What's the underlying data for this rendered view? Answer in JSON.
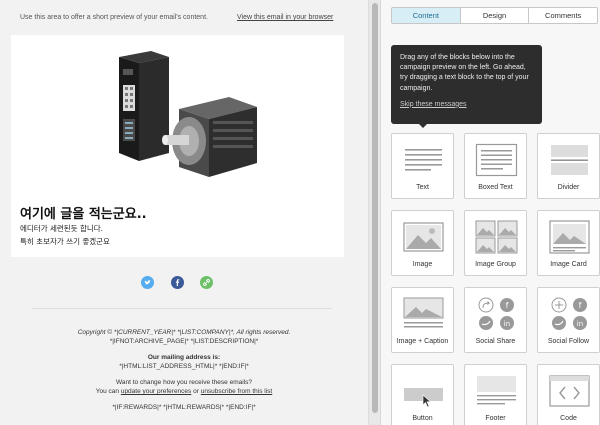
{
  "preview": {
    "preheader_text": "Use this area to offer a short preview of your email's content.",
    "view_in_browser": "View this email in your browser",
    "headline": "여기에 글을 적는군요..",
    "body_line1": "에디터가 세련된듯 합니다.",
    "body_line2": "특히 초보자가 쓰기 좋겠군요",
    "social_icons": [
      {
        "name": "twitter-icon",
        "color": "#55acee"
      },
      {
        "name": "facebook-icon",
        "color": "#3b5998"
      },
      {
        "name": "link-icon",
        "color": "#6dc067"
      }
    ],
    "footer": {
      "copyright": "Copyright © *|CURRENT_YEAR|* *|LIST:COMPANY|*, All rights reserved.",
      "archive": "*|IFNOT:ARCHIVE_PAGE|* *|LIST:DESCRIPTION|*",
      "mailing_heading": "Our mailing address is:",
      "mailing_value": "*|HTML:LIST_ADDRESS_HTML|* *|END:IF|*",
      "change_heading": "Want to change how you receive these emails?",
      "change_prefix": "You can",
      "update_link": "update your preferences",
      "or_text": "or",
      "unsubscribe_link": "unsubscribe from this list",
      "rewards": "*|IF:REWARDS|* *|HTML:REWARDS|* *|END:IF|*"
    }
  },
  "panel": {
    "tabs": [
      {
        "label": "Content",
        "active": true
      },
      {
        "label": "Design",
        "active": false
      },
      {
        "label": "Comments",
        "active": false
      }
    ],
    "tooltip": {
      "text": "Drag any of the blocks below into the campaign preview on the left. Go ahead, try dragging a text block to the top of your campaign.",
      "skip": "Skip these messages"
    },
    "blocks": [
      {
        "label": "Text",
        "icon": "text-block-icon"
      },
      {
        "label": "Boxed Text",
        "icon": "boxed-text-block-icon"
      },
      {
        "label": "Divider",
        "icon": "divider-block-icon"
      },
      {
        "label": "Image",
        "icon": "image-block-icon"
      },
      {
        "label": "Image Group",
        "icon": "image-group-block-icon"
      },
      {
        "label": "Image Card",
        "icon": "image-card-block-icon"
      },
      {
        "label": "Image + Caption",
        "icon": "image-caption-block-icon"
      },
      {
        "label": "Social Share",
        "icon": "social-share-block-icon"
      },
      {
        "label": "Social Follow",
        "icon": "social-follow-block-icon"
      },
      {
        "label": "Button",
        "icon": "button-block-icon"
      },
      {
        "label": "Footer",
        "icon": "footer-block-icon"
      },
      {
        "label": "Code",
        "icon": "code-block-icon"
      }
    ]
  }
}
